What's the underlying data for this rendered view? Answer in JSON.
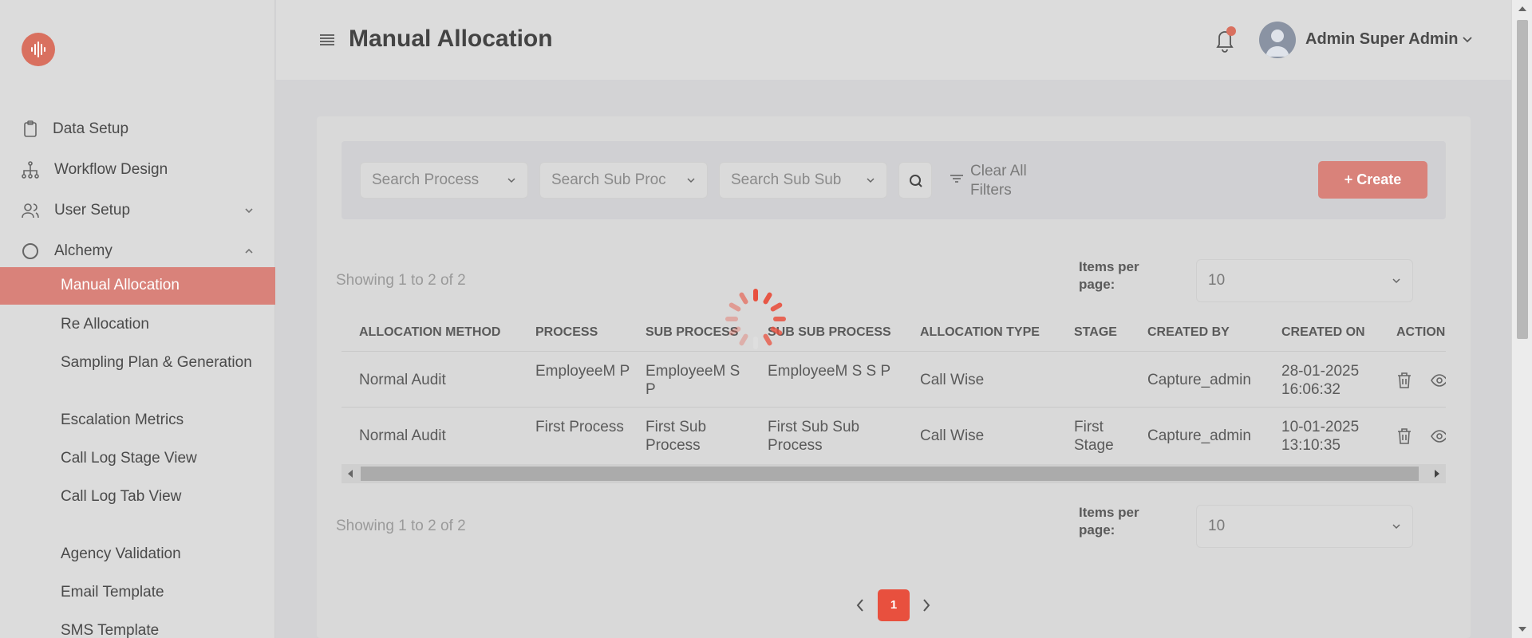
{
  "colors": {
    "accent": "#d9705f",
    "active_bg": "#d9827a",
    "page_active": "#e8503e"
  },
  "sidebar": {
    "items": [
      {
        "label": "Data Setup",
        "icon": "clipboard-icon"
      },
      {
        "label": "Workflow Design",
        "icon": "hierarchy-icon"
      },
      {
        "label": "User Setup",
        "icon": "users-icon"
      },
      {
        "label": "Alchemy",
        "icon": "circle-icon"
      }
    ],
    "submenu": [
      "Manual Allocation",
      "Re Allocation",
      "Sampling Plan & Generation",
      "Escalation Metrics",
      "Call Log Stage View",
      "Call Log Tab View",
      "Agency Validation",
      "Email Template",
      "SMS Template"
    ]
  },
  "header": {
    "title": "Manual Allocation",
    "user_name": "Admin Super Admin"
  },
  "filters": {
    "process_placeholder": "Search Process",
    "sub_process_placeholder": "Search Sub Proc",
    "sub_sub_process_placeholder": "Search Sub Sub",
    "clear_label": "Clear All Filters",
    "create_label": "+ Create"
  },
  "pagination_info": {
    "showing": "Showing 1 to 2 of 2",
    "items_per_page_label": "Items per page:",
    "items_per_page_value": "10",
    "current_page": "1"
  },
  "table": {
    "headers": [
      "ALLOCATION METHOD",
      "PROCESS",
      "SUB PROCESS",
      "SUB SUB PROCESS",
      "ALLOCATION TYPE",
      "STAGE",
      "CREATED BY",
      "CREATED ON",
      "ACTION"
    ],
    "rows": [
      {
        "method": "Normal Audit",
        "process": "EmployeeM P",
        "sub_process": "EmployeeM S P",
        "sub_sub_process": "EmployeeM S S P",
        "type": "Call Wise",
        "stage": "",
        "created_by": "Capture_admin",
        "created_on": "28-01-2025 16:06:32"
      },
      {
        "method": "Normal Audit",
        "process": "First Process",
        "sub_process": "First Sub Process",
        "sub_sub_process": "First Sub Sub Process",
        "type": "Call Wise",
        "stage": "First Stage",
        "created_by": "Capture_admin",
        "created_on": "10-01-2025 13:10:35"
      }
    ]
  }
}
